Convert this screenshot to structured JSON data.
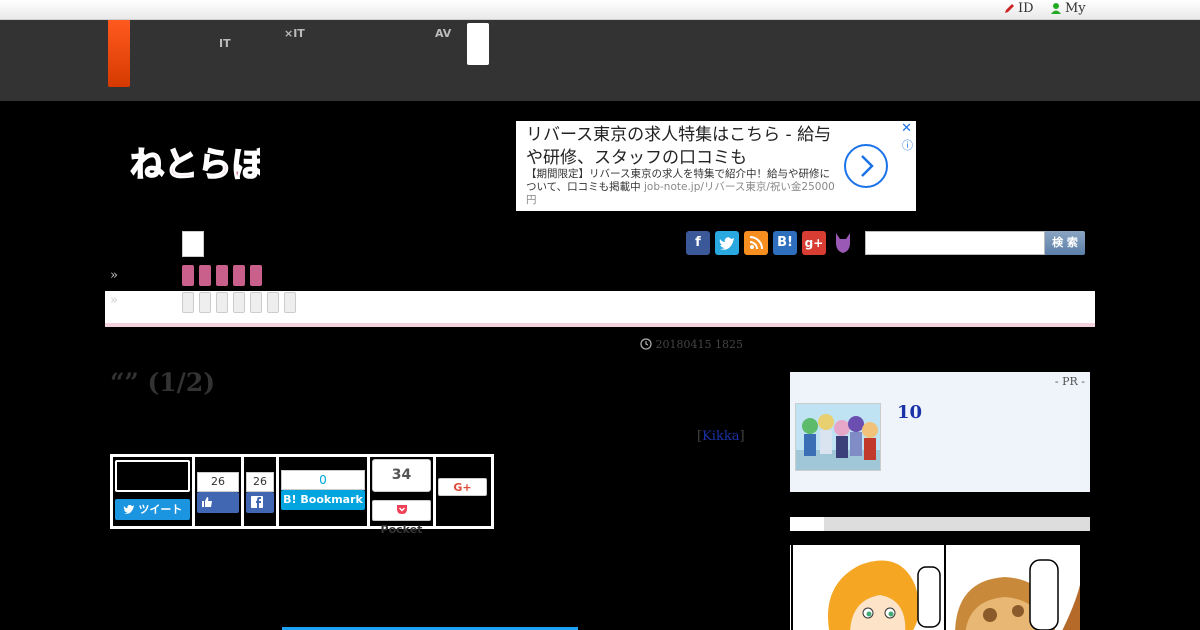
{
  "util": {
    "id_label": "ID",
    "my_label": "My"
  },
  "nav": {
    "item1_top": "",
    "item1_bottom": "IT",
    "item2_top": "",
    "item2_bottom": "×IT",
    "item3_top": "AV",
    "item3_bottom": ""
  },
  "ad": {
    "headline": "リバース東京の求人特集はこちら - 給与や研修、スタッフの口コミも",
    "body": "【期間限定】リバース東京の求人を特集で紹介中！給与や研修について、口コミも掲載中",
    "url": "job-note.jp/リバース東京/祝い金25000円",
    "close": "✕",
    "info": "ⓘ"
  },
  "search": {
    "button": "検 索",
    "placeholder": ""
  },
  "breadcrumb": {
    "raquo1": "»",
    "raquo2": "»"
  },
  "article": {
    "date": "20180415 1825",
    "title": "“” (1/2)",
    "author_open": "[",
    "author": "Kikka",
    "author_close": "]"
  },
  "share": {
    "tweet": "ツイート",
    "like_count": "26",
    "fb_count": "26",
    "bookmark_count": "0",
    "bookmark": "Bookmark",
    "pocket_count": "34",
    "pocket": "Pocket",
    "gplus": "G+"
  },
  "sidebar": {
    "pr_label": "- PR -",
    "pr_title": "10"
  },
  "colors": {
    "accent": "#ff5a1f",
    "header_bg": "#333333",
    "pink": "#c9608c",
    "twitter": "#1b95e0",
    "facebook": "#4267b2",
    "hatena": "#00a4de",
    "pocket": "#ef4056"
  }
}
